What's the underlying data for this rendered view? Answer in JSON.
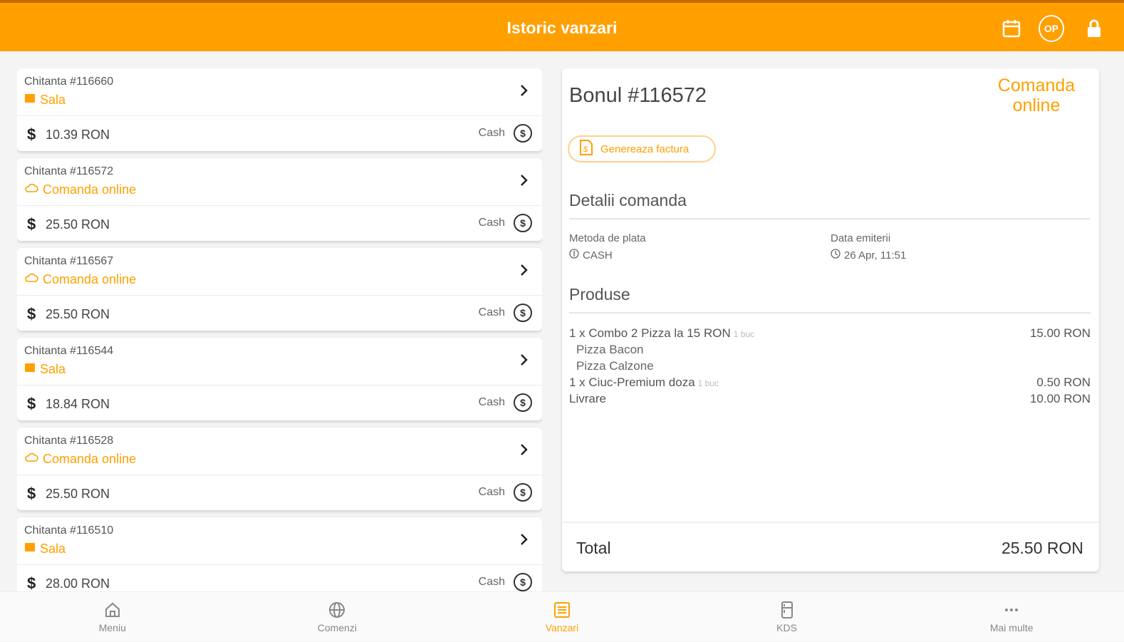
{
  "header": {
    "title": "Istoric vanzari",
    "op_badge": "OP"
  },
  "receipts": [
    {
      "number": "Chitanta #116660",
      "location": "Sala",
      "loc_type": "sala",
      "amount": "10.39 RON",
      "payment": "Cash"
    },
    {
      "number": "Chitanta #116572",
      "location": "Comanda online",
      "loc_type": "online",
      "amount": "25.50 RON",
      "payment": "Cash"
    },
    {
      "number": "Chitanta #116567",
      "location": "Comanda online",
      "loc_type": "online",
      "amount": "25.50 RON",
      "payment": "Cash"
    },
    {
      "number": "Chitanta #116544",
      "location": "Sala",
      "loc_type": "sala",
      "amount": "18.84 RON",
      "payment": "Cash"
    },
    {
      "number": "Chitanta #116528",
      "location": "Comanda online",
      "loc_type": "online",
      "amount": "25.50 RON",
      "payment": "Cash"
    },
    {
      "number": "Chitanta #116510",
      "location": "Sala",
      "loc_type": "sala",
      "amount": "28.00 RON",
      "payment": "Cash"
    }
  ],
  "detail": {
    "title": "Bonul #116572",
    "order_type": "Comanda online",
    "generate_invoice": "Genereaza factura",
    "order_details_heading": "Detalii comanda",
    "payment_method_label": "Metoda de plata",
    "payment_method_value": "CASH",
    "issue_date_label": "Data emiterii",
    "issue_date_value": "26 Apr, 11:51",
    "products_heading": "Produse",
    "products": [
      {
        "name": "1 x Combo 2 Pizza la 15 RON",
        "qty": "1 buc",
        "price": "15.00 RON"
      },
      {
        "name": "Pizza Bacon",
        "sub": true
      },
      {
        "name": "Pizza Calzone",
        "sub": true
      },
      {
        "name": "1 x Ciuc-Premium doza",
        "qty": "1 buc",
        "price": "0.50 RON"
      },
      {
        "name": "Livrare",
        "qty": "",
        "price": "10.00 RON"
      }
    ],
    "total_label": "Total",
    "total_value": "25.50 RON"
  },
  "nav": [
    {
      "label": "Meniu",
      "active": false
    },
    {
      "label": "Comenzi",
      "active": false
    },
    {
      "label": "Vanzari",
      "active": true
    },
    {
      "label": "KDS",
      "active": false
    },
    {
      "label": "Mai multe",
      "active": false
    }
  ],
  "colors": {
    "accent": "#ffa000",
    "text": "#333333"
  }
}
